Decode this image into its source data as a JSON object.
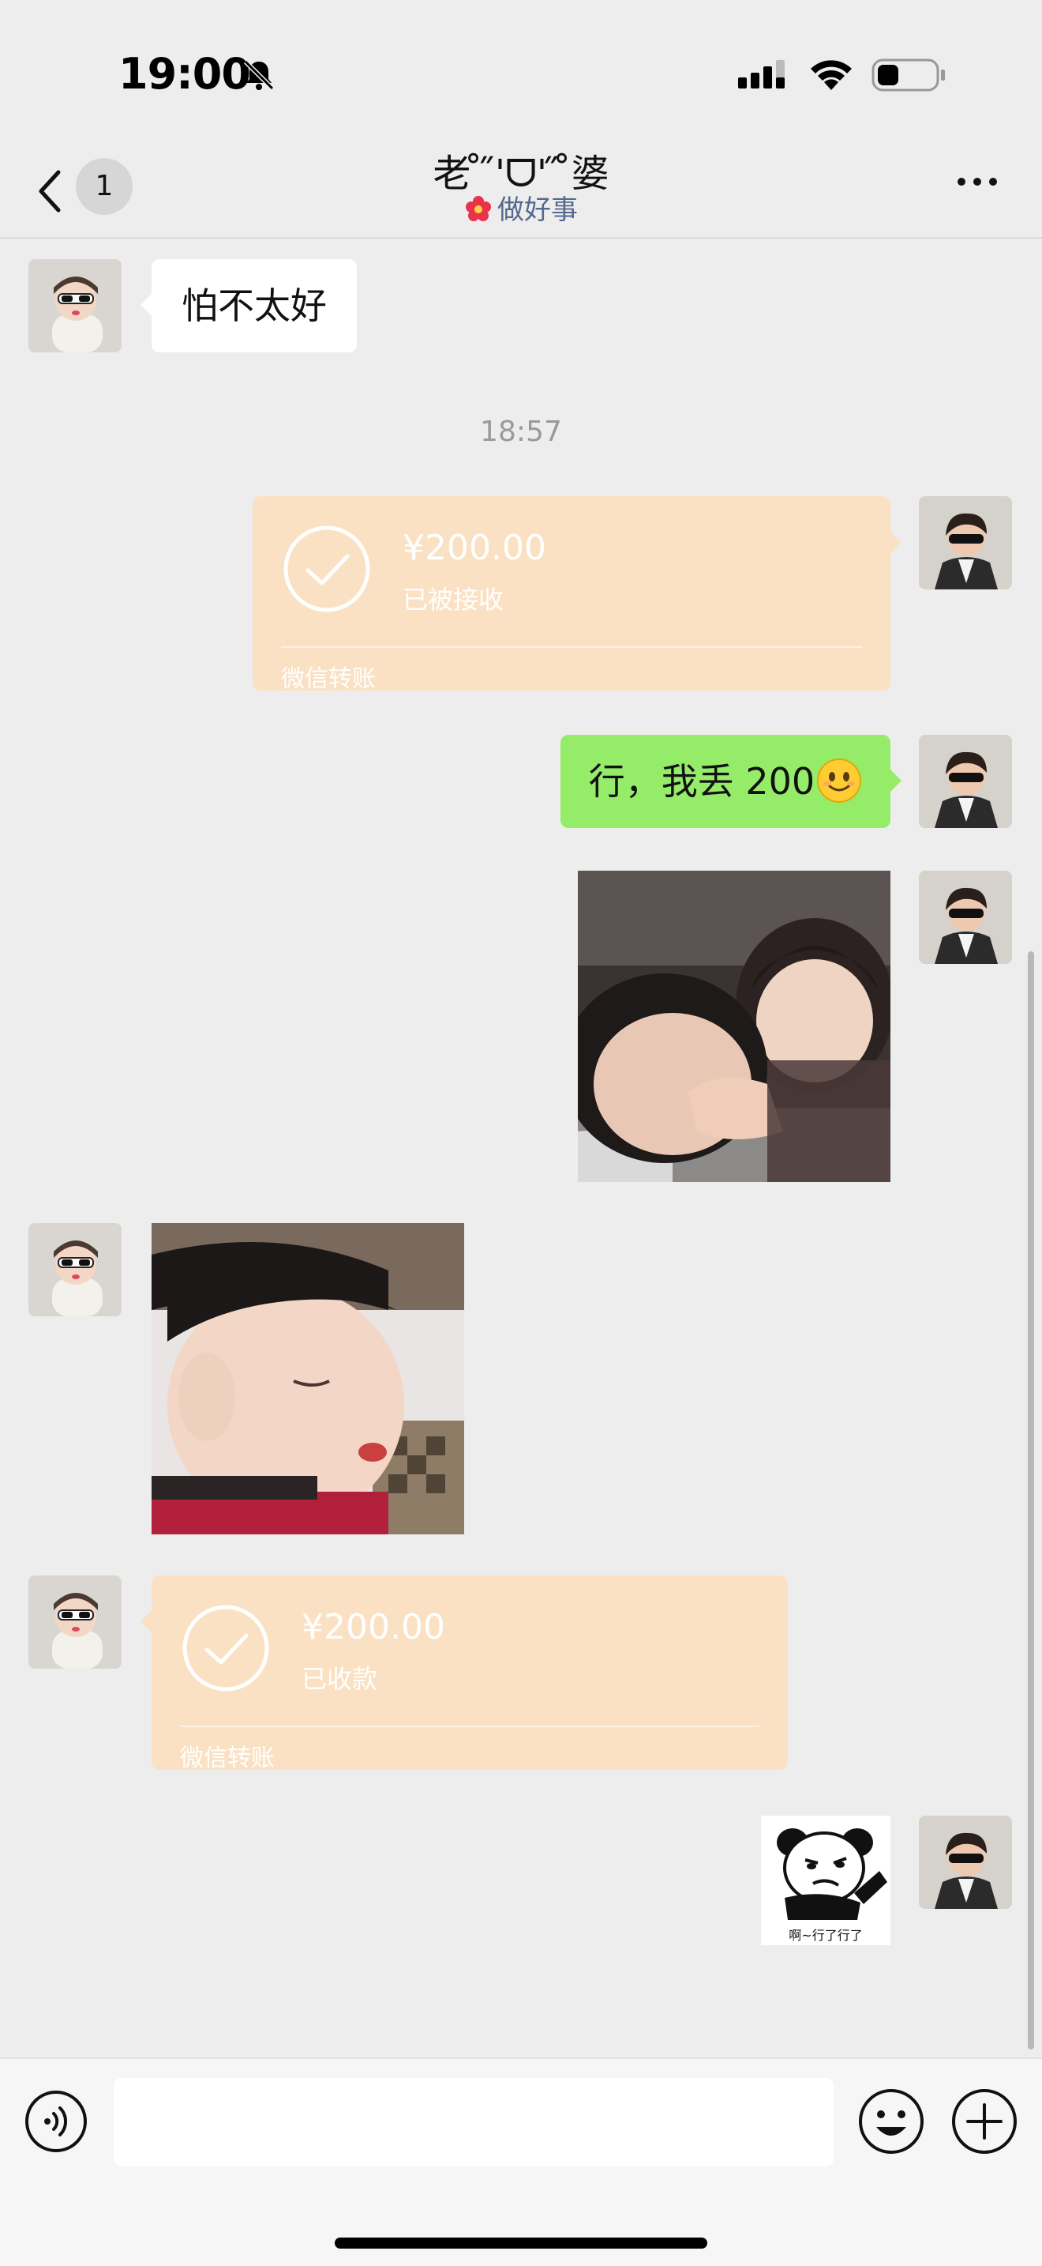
{
  "status_bar": {
    "time": "19:00"
  },
  "header": {
    "back_badge": "1",
    "title": "老 ̊ ̋'ᗜ' ̋ ̊婆",
    "subtitle": "做好事"
  },
  "messages": [
    {
      "kind": "text",
      "side": "left",
      "text": "怕不太好"
    },
    {
      "kind": "timestamp",
      "text": "18:57"
    },
    {
      "kind": "transfer",
      "side": "right",
      "amount": "¥200.00",
      "status": "已被接收",
      "footer": "微信转账"
    },
    {
      "kind": "text",
      "side": "right",
      "text": "行，我丢 200",
      "emoji": "smiling-face-emoji"
    },
    {
      "kind": "image",
      "side": "right",
      "subject": "two-toddlers-photo"
    },
    {
      "kind": "image",
      "side": "left",
      "subject": "sleeping-toddler-photo"
    },
    {
      "kind": "transfer",
      "side": "left",
      "amount": "¥200.00",
      "status": "已收款",
      "footer": "微信转账"
    },
    {
      "kind": "sticker",
      "side": "right",
      "caption": "啊~行了行了"
    }
  ],
  "input_bar": {
    "draft": ""
  },
  "colors": {
    "background": "#ededed",
    "bubble_green": "#95ec69",
    "bubble_white": "#ffffff",
    "transfer": "#fbe1c3",
    "subtitle": "#55698f"
  }
}
